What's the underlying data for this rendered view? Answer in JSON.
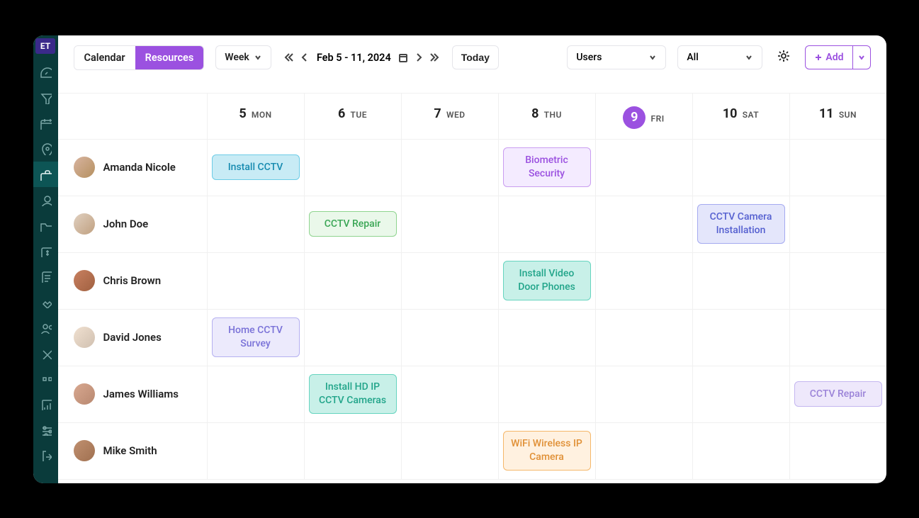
{
  "logo": "ET",
  "tabs": {
    "calendar": "Calendar",
    "resources": "Resources",
    "active": "resources"
  },
  "view_select": "Week",
  "date_range": "Feb 5 - 11, 2024",
  "today_label": "Today",
  "filter1": "Users",
  "filter2": "All",
  "add_label": "Add",
  "days": [
    {
      "num": "5",
      "name": "MON",
      "today": false
    },
    {
      "num": "6",
      "name": "TUE",
      "today": false
    },
    {
      "num": "7",
      "name": "WED",
      "today": false
    },
    {
      "num": "8",
      "name": "THU",
      "today": false
    },
    {
      "num": "9",
      "name": "FRI",
      "today": true
    },
    {
      "num": "10",
      "name": "SAT",
      "today": false
    },
    {
      "num": "11",
      "name": "SUN",
      "today": false
    }
  ],
  "resources": [
    {
      "name": "Amanda Nicole",
      "avatar_bg": "linear-gradient(135deg,#d8b4a0,#b5905f)",
      "events": {
        "0": {
          "label": "Install CCTV",
          "cls": "ev-skyblue"
        },
        "3": {
          "label": "Biometric Security",
          "cls": "ev-lavender"
        }
      }
    },
    {
      "name": "John Doe",
      "avatar_bg": "linear-gradient(135deg,#e0d0c0,#c0a080)",
      "events": {
        "1": {
          "label": "CCTV Repair",
          "cls": "ev-lightgreen"
        },
        "5": {
          "label": "CCTV Camera Installation",
          "cls": "ev-indigo"
        }
      }
    },
    {
      "name": "Chris Brown",
      "avatar_bg": "linear-gradient(135deg,#c88060,#a06040)",
      "events": {
        "3": {
          "label": "Install Video Door Phones",
          "cls": "ev-teal"
        }
      }
    },
    {
      "name": "David Jones",
      "avatar_bg": "linear-gradient(135deg,#f0e0d0,#d0c0b0)",
      "events": {
        "0": {
          "label": "Home CCTV Survey",
          "cls": "ev-periwinkle"
        }
      }
    },
    {
      "name": "James Williams",
      "avatar_bg": "linear-gradient(135deg,#d8a890,#b88870)",
      "events": {
        "1": {
          "label": "Install HD IP CCTV Cameras",
          "cls": "ev-teal"
        },
        "6": {
          "label": "CCTV Repair",
          "cls": "ev-lilac"
        }
      }
    },
    {
      "name": "Mike Smith",
      "avatar_bg": "linear-gradient(135deg,#c09070,#a07050)",
      "events": {
        "3": {
          "label": "WiFi Wireless IP Camera",
          "cls": "ev-orange"
        }
      }
    }
  ]
}
